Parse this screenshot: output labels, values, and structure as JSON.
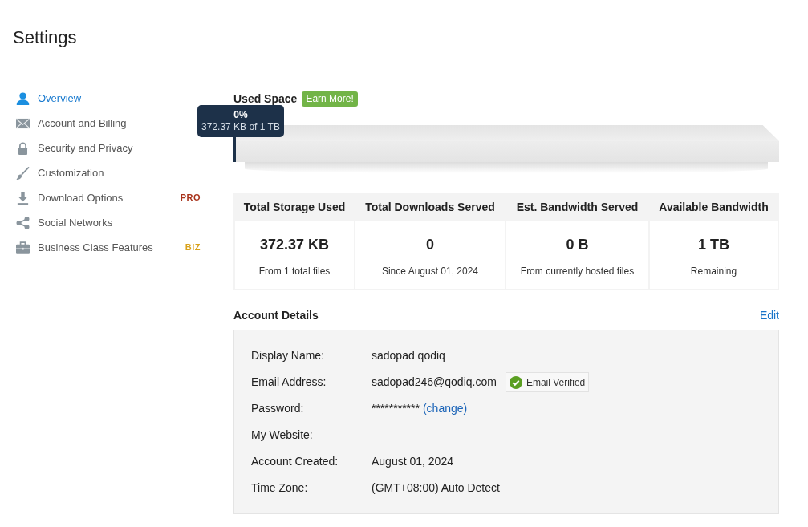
{
  "page": {
    "title": "Settings"
  },
  "sidebar": {
    "items": [
      {
        "label": "Overview",
        "selected": true
      },
      {
        "label": "Account and Billing",
        "selected": false
      },
      {
        "label": "Security and Privacy",
        "selected": false
      },
      {
        "label": "Customization",
        "selected": false
      },
      {
        "label": "Download Options",
        "selected": false,
        "badge": {
          "text": "PRO",
          "color": "#a8321a"
        }
      },
      {
        "label": "Social Networks",
        "selected": false
      },
      {
        "label": "Business Class Features",
        "selected": false,
        "badge": {
          "text": "BIZ",
          "color": "#d9a21c"
        }
      }
    ]
  },
  "used_space": {
    "title": "Used Space",
    "earn_more": "Earn More!",
    "level": 0,
    "tooltip": {
      "percent": "0%",
      "detail": "372.37 KB of 1 TB"
    }
  },
  "stats": [
    {
      "heading": "Total Storage Used",
      "value": "372.37 KB",
      "note": "From 1 total files"
    },
    {
      "heading": "Total Downloads Served",
      "value": "0",
      "note": "Since August 01, 2024"
    },
    {
      "heading": "Est. Bandwidth Served",
      "value": "0 B",
      "note": "From currently hosted files"
    },
    {
      "heading": "Available Bandwidth",
      "value": "1 TB",
      "note": "Remaining"
    }
  ],
  "account_details": {
    "title": "Account Details",
    "edit": "Edit",
    "rows": [
      {
        "label": "Display Name:",
        "value": "sadopad qodiq"
      },
      {
        "label": "Email Address:",
        "value": "sadopad246@qodiq.com",
        "badge": "Email Verified"
      },
      {
        "label": "Password:",
        "value": "***********",
        "link": "(change)"
      },
      {
        "label": "My Website:"
      },
      {
        "label": "Account Created:",
        "value": "August 01, 2024"
      },
      {
        "label": "Time Zone:",
        "value": "(GMT+08:00) Auto Detect"
      }
    ]
  }
}
